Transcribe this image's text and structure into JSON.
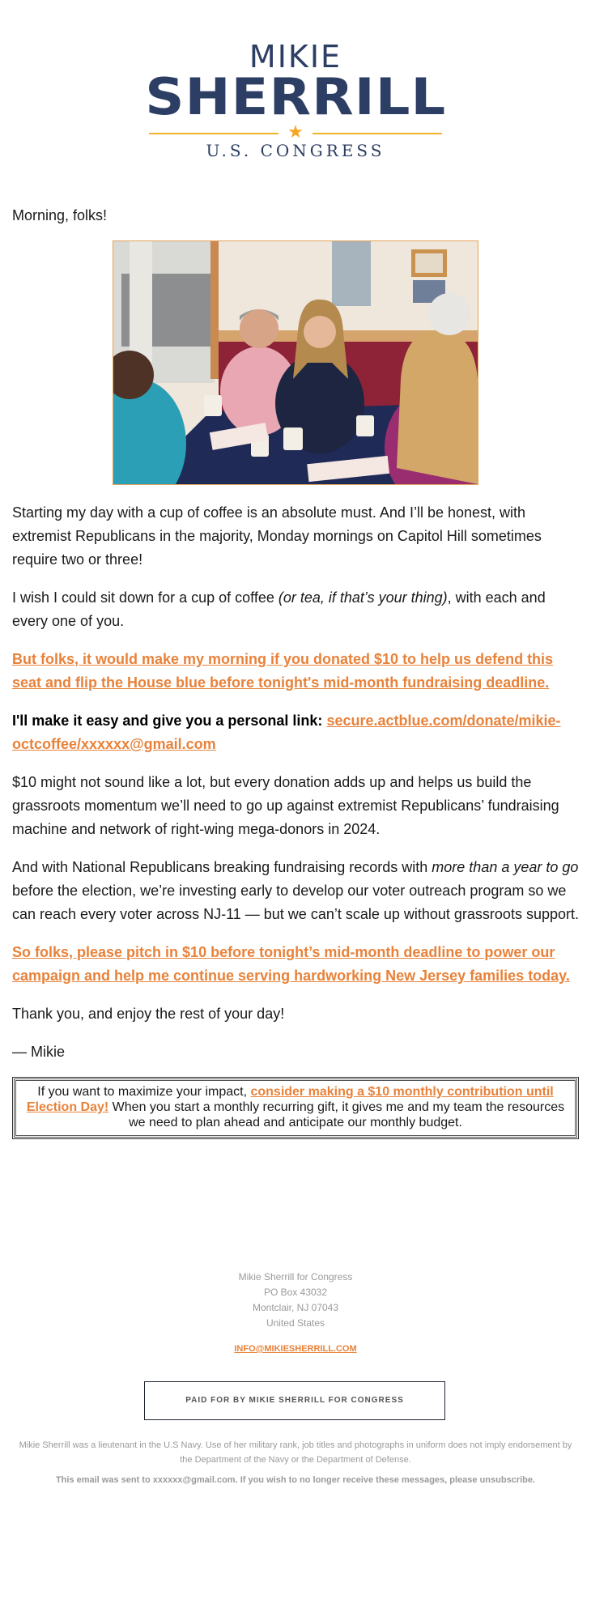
{
  "logo": {
    "first_name": "MIKIE",
    "last_name": "SHERRILL",
    "star_icon": "star-icon",
    "subtitle": "U.S. CONGRESS"
  },
  "body": {
    "greeting": "Morning, folks!",
    "photo_alt": "Mikie Sherrill having coffee with constituents at a diner table",
    "p1": "Starting my day with a cup of coffee is an absolute must. And I’ll be honest, with extremist Republicans in the majority, Monday mornings on Capitol Hill sometimes require two or three!",
    "p2_before": "I wish I could sit down for a cup of coffee ",
    "p2_italic": "(or tea, if that’s your thing)",
    "p2_after": ", with each and every one of you.",
    "cta1": "But folks, it would make my morning if you donated $10 to help us defend this seat and flip the House blue before tonight's mid-month fundraising deadline.",
    "link_intro": "I'll make it easy and give you a personal link: ",
    "personal_link": "secure.actblue.com/donate/mikie-octcoffee/xxxxxx@gmail.com",
    "p3": "$10 might not sound like a lot, but every donation adds up and helps us build the grassroots momentum we’ll need to go up against extremist Republicans’ fundraising machine and network of right-wing mega-donors in 2024.",
    "p4_before": "And with National Republicans breaking fundraising records with ",
    "p4_italic": "more than a year to go",
    "p4_after": " before the election, we’re investing early to develop our voter outreach program so we can reach every voter across NJ-11 — but we can’t scale up without grassroots support.",
    "cta2": "So folks, please pitch in $10 before tonight’s mid-month deadline to power our campaign and help me continue serving hardworking New Jersey families today.",
    "thanks": "Thank you, and enjoy the rest of your day!",
    "signoff": "— Mikie",
    "box_before": "If you want to maximize your impact, ",
    "box_link": "consider making a $10 monthly contribution until Election Day!",
    "box_after": " When you start a monthly recurring gift, it gives me and my team the resources we need to plan ahead and anticipate our monthly budget."
  },
  "footer": {
    "org": "Mikie Sherrill for Congress",
    "po_box": "PO Box 43032",
    "city": "Montclair, NJ 07043",
    "country": "United States",
    "email": "INFO@MIKIESHERRILL.COM",
    "paid_for": "PAID FOR BY MIKIE SHERRILL FOR CONGRESS",
    "disclaimer": "Mikie Sherrill was a lieutenant in the U.S Navy. Use of her military rank, job titles and photographs in uniform does not imply endorsement by the Department of the Navy or the Department of Defense.",
    "sent_to": "This email was sent to xxxxxx@gmail.com. If you wish to no longer receive these messages, please unsubscribe."
  },
  "colors": {
    "navy": "#2c3e63",
    "gold": "#f5a623",
    "link_orange": "#e8823a",
    "footer_gray": "#9a9a9a"
  }
}
